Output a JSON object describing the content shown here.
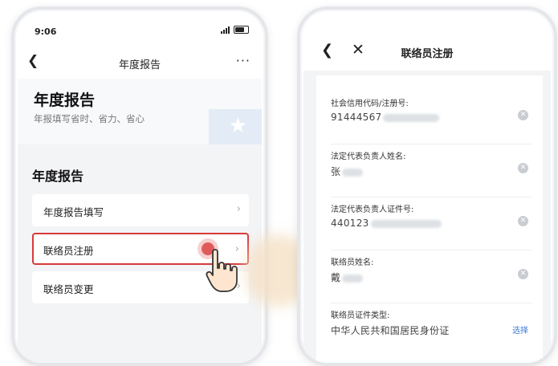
{
  "left_screen": {
    "status_time": "9:06",
    "nav_title": "年度报告",
    "banner_title": "年度报告",
    "banner_subtitle": "年报填写省时、省力、省心",
    "section_title": "年度报告",
    "menu_items": [
      {
        "label": "年度报告填写"
      },
      {
        "label": "联络员注册"
      },
      {
        "label": "联络员变更"
      }
    ]
  },
  "right_screen": {
    "nav_title": "联络员注册",
    "fields": [
      {
        "label": "社会信用代码/注册号:",
        "value": "91444567"
      },
      {
        "label": "法定代表负责人姓名:",
        "value": "张"
      },
      {
        "label": "法定代表负责人证件号:",
        "value": "440123"
      },
      {
        "label": "联络员姓名:",
        "value": "戴"
      },
      {
        "label": "联络员证件类型:",
        "value": "中华人民共和国居民身份证",
        "action": "选择"
      }
    ]
  },
  "colors": {
    "highlight_border": "#d93a3a",
    "link_blue": "#3b7bd9"
  }
}
